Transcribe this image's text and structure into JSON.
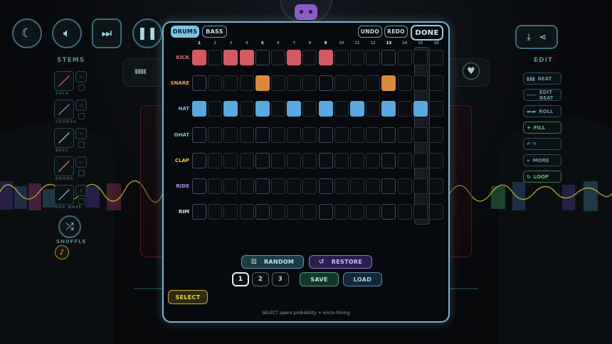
{
  "top_controls": {
    "night_icon": "moon-icon",
    "volume_icon": "speaker-icon",
    "skip_icon": "skip-forward-icon",
    "pause_icon": "pause-icon"
  },
  "stems": {
    "title": "STEMS",
    "items": [
      {
        "name": "stem-1",
        "label": "SOLO",
        "color": "#d64f6b"
      },
      {
        "name": "stem-2",
        "label": "CHORDS",
        "color": "#6b7fd6"
      },
      {
        "name": "stem-3",
        "label": "BASS",
        "color": "#9ab88a"
      },
      {
        "name": "stem-4",
        "label": "DRUMS",
        "color": "#d66b4f"
      },
      {
        "name": "stem-5",
        "label": "PAD WAVE",
        "color": "#7aa0c4"
      }
    ],
    "shuffle_label": "SHUFFLE"
  },
  "edit": {
    "title": "EDIT",
    "download_icon": "download-icon",
    "share_icon": "share-icon",
    "items": [
      {
        "label": "BEAT",
        "icon": "bars-icon",
        "green": false
      },
      {
        "label": "EDIT BEAT",
        "icon": "dots-icon",
        "green": false
      },
      {
        "label": "ROLL",
        "icon": "roll-icon",
        "green": false
      },
      {
        "label": "FILL",
        "icon": "sparkle-icon",
        "green": true
      },
      {
        "label": "",
        "icon": "undo-redo-icon",
        "green": false
      },
      {
        "label": "MORE",
        "icon": "chevrons-icon",
        "green": false
      },
      {
        "label": "LOOP",
        "icon": "loop-icon",
        "green": true
      }
    ]
  },
  "modal": {
    "tabs": {
      "drums": "DRUMS",
      "bass": "BASS"
    },
    "undo": "UNDO",
    "redo": "REDO",
    "done": "DONE",
    "columns": [
      "1",
      "2",
      "3",
      "4",
      "5",
      "6",
      "7",
      "8",
      "9",
      "10",
      "11",
      "12",
      "13",
      "14",
      "15",
      "16"
    ],
    "bold_columns": [
      1,
      5,
      9,
      13
    ],
    "playhead_step": 15,
    "rows": [
      {
        "label": "KICK",
        "color": "#ee6b7a",
        "fill": "#d35a63",
        "steps": [
          1,
          0,
          1,
          1,
          0,
          0,
          1,
          0,
          1,
          0,
          0,
          0,
          0,
          0,
          0,
          0
        ]
      },
      {
        "label": "SNARE",
        "color": "#f0a548",
        "fill": "#d98a3c",
        "steps": [
          0,
          0,
          0,
          0,
          1,
          0,
          0,
          0,
          0,
          0,
          0,
          0,
          1,
          0,
          0,
          0
        ]
      },
      {
        "label": "HAT",
        "color": "#6fc0ec",
        "fill": "#5aa8de",
        "steps": [
          1,
          0,
          1,
          0,
          1,
          0,
          1,
          0,
          1,
          0,
          1,
          0,
          1,
          0,
          1,
          0
        ]
      },
      {
        "label": "OHAT",
        "color": "#7fc9ac",
        "fill": "#5fb08f",
        "steps": [
          0,
          0,
          0,
          0,
          0,
          0,
          0,
          0,
          0,
          0,
          0,
          0,
          0,
          0,
          0,
          0
        ]
      },
      {
        "label": "CLAP",
        "color": "#f2c14e",
        "fill": "#d9a83a",
        "steps": [
          0,
          0,
          0,
          0,
          0,
          0,
          0,
          0,
          0,
          0,
          0,
          0,
          0,
          0,
          0,
          0
        ]
      },
      {
        "label": "RIDE",
        "color": "#b68cf2",
        "fill": "#9b72d6",
        "steps": [
          0,
          0,
          0,
          0,
          0,
          0,
          0,
          0,
          0,
          0,
          0,
          0,
          0,
          0,
          0,
          0
        ]
      },
      {
        "label": "RIM",
        "color": "#e3e7ea",
        "fill": "#c4c9cc",
        "steps": [
          0,
          0,
          0,
          0,
          0,
          0,
          0,
          0,
          0,
          0,
          0,
          0,
          0,
          0,
          0,
          0
        ]
      }
    ],
    "random": "RANDOM",
    "restore": "RESTORE",
    "slots": [
      "1",
      "2",
      "3"
    ],
    "active_slot": 1,
    "save": "SAVE",
    "load": "LOAD",
    "select": "SELECT",
    "hint": "SELECT opens probability + micro-timing"
  }
}
